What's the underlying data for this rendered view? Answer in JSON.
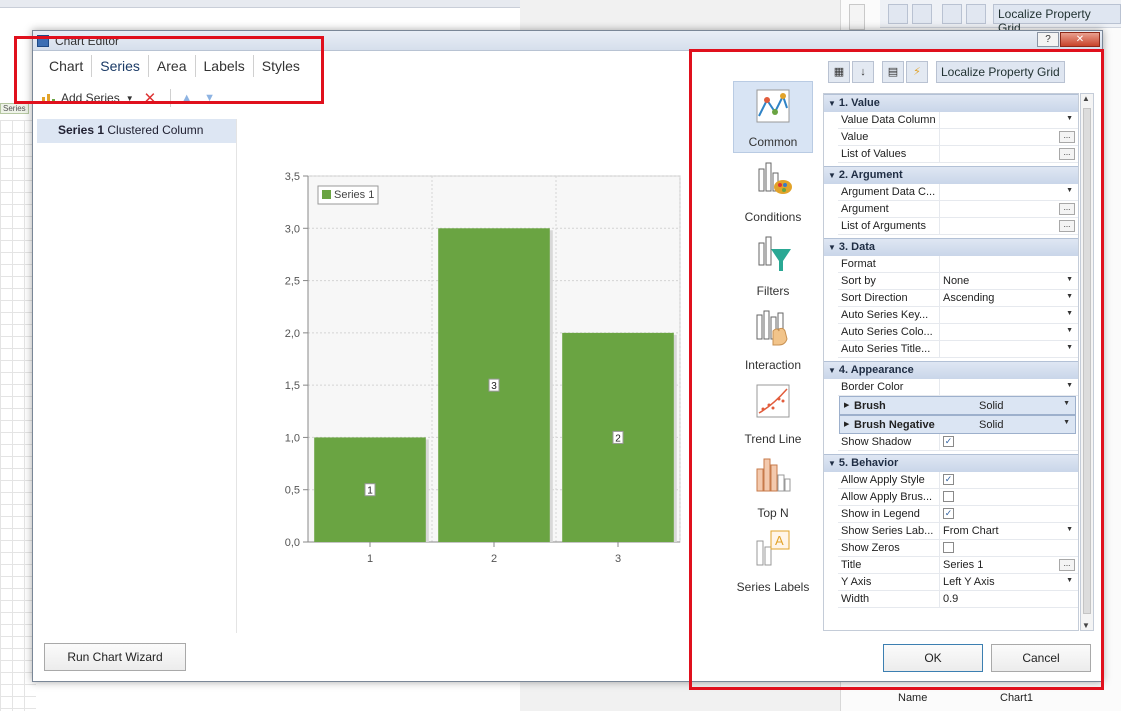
{
  "background": {
    "series_chip": "Series",
    "toolbar_label": "Localize Property Grid",
    "bottom_name_label": "Name",
    "bottom_name_value": "Chart1"
  },
  "dialog": {
    "title": "Chart Editor",
    "help_label": "?",
    "close_label": "✕",
    "tabs": [
      "Chart",
      "Series",
      "Area",
      "Labels",
      "Styles"
    ],
    "active_tab": "Series",
    "toolbar": {
      "add_series_label": "Add Series"
    },
    "series_list": [
      {
        "name": "Series 1",
        "type": "Clustered Column"
      }
    ],
    "run_wizard_label": "Run Chart Wizard",
    "ok_label": "OK",
    "cancel_label": "Cancel"
  },
  "categories": [
    {
      "label": "Common",
      "icon": "common-icon",
      "active": true
    },
    {
      "label": "Conditions",
      "icon": "conditions-icon"
    },
    {
      "label": "Filters",
      "icon": "filters-icon"
    },
    {
      "label": "Interaction",
      "icon": "interaction-icon"
    },
    {
      "label": "Trend Line",
      "icon": "trend-line-icon"
    },
    {
      "label": "Top N",
      "icon": "top-n-icon"
    },
    {
      "label": "Series Labels",
      "icon": "series-labels-icon"
    }
  ],
  "property_grid": {
    "toolbar_label": "Localize Property Grid",
    "groups": [
      {
        "title": "1. Value",
        "rows": [
          {
            "name": "Value Data Column",
            "value": "",
            "editor": "dropdown"
          },
          {
            "name": "Value",
            "value": "",
            "editor": "ellipsis"
          },
          {
            "name": "List of Values",
            "value": "",
            "editor": "ellipsis"
          }
        ]
      },
      {
        "title": "2. Argument",
        "rows": [
          {
            "name": "Argument Data C...",
            "value": "",
            "editor": "dropdown"
          },
          {
            "name": "Argument",
            "value": "",
            "editor": "ellipsis"
          },
          {
            "name": "List of Arguments",
            "value": "",
            "editor": "ellipsis"
          }
        ]
      },
      {
        "title": "3. Data",
        "rows": [
          {
            "name": "Format",
            "value": "",
            "editor": "none"
          },
          {
            "name": "Sort by",
            "value": "None",
            "editor": "dropdown"
          },
          {
            "name": "Sort Direction",
            "value": "Ascending",
            "editor": "dropdown"
          },
          {
            "name": "Auto Series Key...",
            "value": "",
            "editor": "dropdown"
          },
          {
            "name": "Auto Series Colo...",
            "value": "",
            "editor": "dropdown"
          },
          {
            "name": "Auto Series Title...",
            "value": "",
            "editor": "dropdown"
          }
        ]
      },
      {
        "title": "4. Appearance",
        "rows": [
          {
            "name": "Border Color",
            "value": "",
            "editor": "dropdown"
          },
          {
            "name": "Brush",
            "value": "Solid",
            "editor": "sub"
          },
          {
            "name": "Brush Negative",
            "value": "Solid",
            "editor": "sub"
          },
          {
            "name": "Show Shadow",
            "value": true,
            "editor": "checkbox"
          }
        ]
      },
      {
        "title": "5. Behavior",
        "rows": [
          {
            "name": "Allow Apply Style",
            "value": true,
            "editor": "checkbox"
          },
          {
            "name": "Allow Apply Brus...",
            "value": false,
            "editor": "checkbox"
          },
          {
            "name": "Show in Legend",
            "value": true,
            "editor": "checkbox"
          },
          {
            "name": "Show Series Lab...",
            "value": "From Chart",
            "editor": "dropdown"
          },
          {
            "name": "Show Zeros",
            "value": false,
            "editor": "checkbox"
          },
          {
            "name": "Title",
            "value": "Series 1",
            "editor": "ellipsis"
          },
          {
            "name": "Y Axis",
            "value": "Left Y Axis",
            "editor": "dropdown"
          },
          {
            "name": "Width",
            "value": "0.9",
            "editor": "none"
          }
        ]
      }
    ]
  },
  "chart_data": {
    "type": "bar",
    "categories": [
      "1",
      "2",
      "3"
    ],
    "series": [
      {
        "name": "Series 1",
        "values": [
          1,
          3,
          2
        ],
        "color": "#6aa442"
      }
    ],
    "y_ticks": [
      "0,0",
      "0,5",
      "1,0",
      "1,5",
      "2,0",
      "2,5",
      "3,0",
      "3,5"
    ],
    "ylim": [
      0,
      3.5
    ],
    "data_labels": [
      "1",
      "3",
      "2"
    ],
    "grid": true,
    "legend": "top-left"
  },
  "colors": {
    "annotation_red": "#e0101d",
    "bar_green": "#6aa442",
    "selection_blue": "#dde6f3"
  }
}
